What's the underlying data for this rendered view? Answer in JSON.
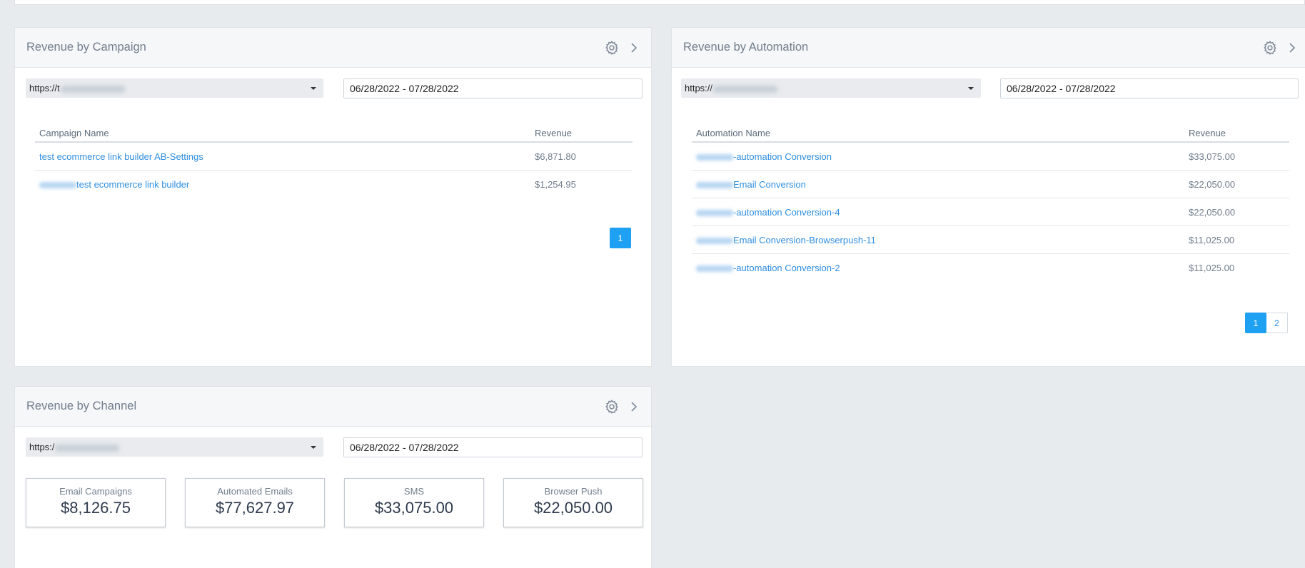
{
  "campaign": {
    "title": "Revenue by Campaign",
    "url_prefix": "https://t",
    "date_range": "06/28/2022 - 07/28/2022",
    "columns": [
      "Campaign Name",
      "Revenue"
    ],
    "rows": [
      {
        "name": "test ecommerce link builder AB-Settings",
        "revenue": "$6,871.80"
      },
      {
        "name": "test ecommerce link builder",
        "revenue": "$1,254.95"
      }
    ],
    "pages": [
      "1"
    ]
  },
  "automation": {
    "title": "Revenue by Automation",
    "url_prefix": "https://",
    "date_range": "06/28/2022 - 07/28/2022",
    "columns": [
      "Automation Name",
      "Revenue"
    ],
    "rows": [
      {
        "name": "-automation Conversion",
        "revenue": "$33,075.00"
      },
      {
        "name": "Email Conversion",
        "revenue": "$22,050.00"
      },
      {
        "name": "-automation Conversion-4",
        "revenue": "$22,050.00"
      },
      {
        "name": "Email Conversion-Browserpush-11",
        "revenue": "$11,025.00"
      },
      {
        "name": "-automation Conversion-2",
        "revenue": "$11,025.00"
      }
    ],
    "pages": [
      "1",
      "2"
    ]
  },
  "channel": {
    "title": "Revenue by Channel",
    "url_prefix": "https:/",
    "date_range": "06/28/2022 - 07/28/2022",
    "stats": [
      {
        "label": "Email Campaigns",
        "value": "$8,126.75"
      },
      {
        "label": "Automated Emails",
        "value": "$77,627.97"
      },
      {
        "label": "SMS",
        "value": "$33,075.00"
      },
      {
        "label": "Browser Push",
        "value": "$22,050.00"
      }
    ]
  },
  "icons": {
    "settings": "gear-icon",
    "navigate": "chevron-right-icon"
  },
  "colors": {
    "link": "#2f8ee0",
    "accent": "#1ea1f2",
    "header_bg": "#f6f7f9",
    "page_bg": "#e8ebee"
  }
}
